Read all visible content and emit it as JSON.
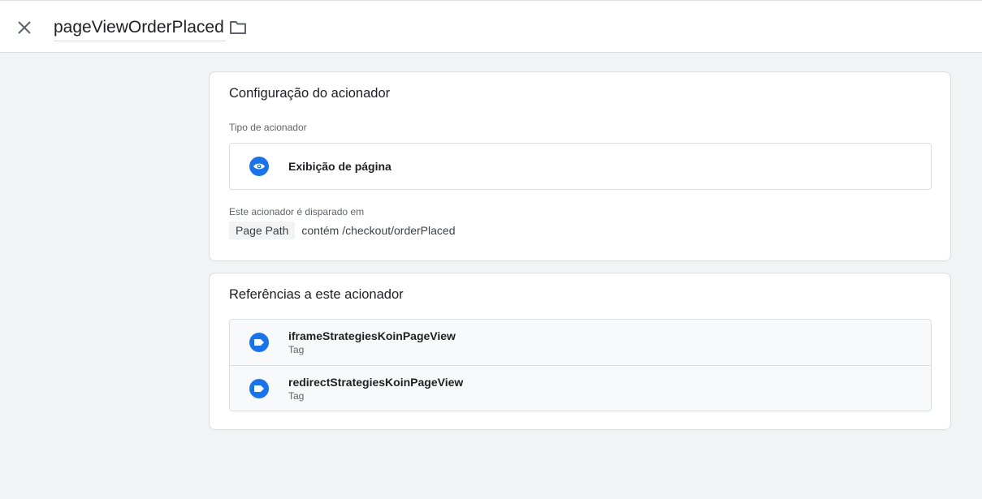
{
  "header": {
    "close_icon": "close-icon",
    "trigger_name": "pageViewOrderPlaced",
    "folder_icon": "folder-icon"
  },
  "config": {
    "title": "Configuração do acionador",
    "type_label": "Tipo de acionador",
    "type_icon": "eye-icon",
    "type_name": "Exibição de página",
    "fires_on_label": "Este acionador é disparado em",
    "condition": {
      "variable": "Page Path",
      "expression": "contém /checkout/orderPlaced"
    }
  },
  "references": {
    "title": "Referências a este acionador",
    "items": [
      {
        "name": "iframeStrategiesKoinPageView",
        "type": "Tag",
        "icon": "tag-icon"
      },
      {
        "name": "redirectStrategiesKoinPageView",
        "type": "Tag",
        "icon": "tag-icon"
      }
    ]
  },
  "colors": {
    "accent": "#1a73e8",
    "background": "#f1f3f4",
    "card": "#ffffff",
    "border": "#dadce0"
  }
}
